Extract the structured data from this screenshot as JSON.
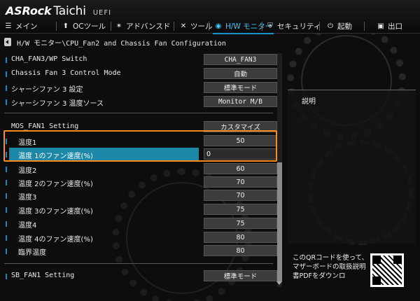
{
  "brand": {
    "name": "ASRock",
    "model": "Taichi",
    "tag": "UEFI"
  },
  "menu": [
    {
      "id": "main",
      "icon": "list-icon",
      "glyph": "☰",
      "label": "メイン"
    },
    {
      "id": "oc",
      "icon": "rocket-icon",
      "glyph": "⬆",
      "label": "OCツール"
    },
    {
      "id": "advanced",
      "icon": "star-icon",
      "glyph": "✶",
      "label": "アドバンスド"
    },
    {
      "id": "tool",
      "icon": "tools-icon",
      "glyph": "✕",
      "label": "ツール"
    },
    {
      "id": "hw",
      "icon": "monitor-icon",
      "glyph": "◉",
      "label": "H/W モニター",
      "active": true
    },
    {
      "id": "security",
      "icon": "shield-icon",
      "glyph": "⛨",
      "label": "セキュリティ"
    },
    {
      "id": "boot",
      "icon": "power-icon",
      "glyph": "⏻",
      "label": "起動"
    },
    {
      "id": "exit",
      "icon": "exit-icon",
      "glyph": "▣",
      "label": "出口"
    }
  ],
  "breadcrumb": "H/W モニター\\CPU_Fan2 and Chassis Fan Configuration",
  "settings": {
    "cha_fan3_switch": {
      "label": "CHA_FAN3/WP Switch",
      "value": "CHA_FAN3"
    },
    "chassis_fan3_mode": {
      "label": "Chassis Fan 3 Control Mode",
      "value": "自動"
    },
    "chassis_fan3_setting": {
      "label": "シャーシファン 3 設定",
      "value": "標準モード"
    },
    "chassis_fan3_temp_source": {
      "label": "シャーシファン 3 温度ソース",
      "value": "Monitor M/B"
    },
    "mos_fan1_setting": {
      "label": "MOS_FAN1 Setting",
      "value": "カスタマイズ"
    },
    "temp1": {
      "label": "温度1",
      "value": "50"
    },
    "temp1_fan_speed": {
      "label": "温度 1のファン速度(%)",
      "value": "0"
    },
    "temp2": {
      "label": "温度2",
      "value": "60"
    },
    "temp2_fan_speed": {
      "label": "温度 2のファン速度(%)",
      "value": "70"
    },
    "temp3": {
      "label": "温度3",
      "value": "70"
    },
    "temp3_fan_speed": {
      "label": "温度 3のファン速度(%)",
      "value": "75"
    },
    "temp4": {
      "label": "温度4",
      "value": "75"
    },
    "temp4_fan_speed": {
      "label": "温度 4のファン速度(%)",
      "value": "80"
    },
    "critical_temp": {
      "label": "臨界温度",
      "value": "80"
    },
    "sb_fan1_setting": {
      "label": "SB_FAN1 Setting",
      "value": "標準モード"
    }
  },
  "description": {
    "title": "説明"
  },
  "qr": {
    "text": "このQRコードを使って、マザーボードの取扱説明書PDFをダウンロ"
  },
  "colors": {
    "accent": "#1c87a6",
    "active_tab": "#40c8ff",
    "highlight_box": "#ff8c1a"
  }
}
